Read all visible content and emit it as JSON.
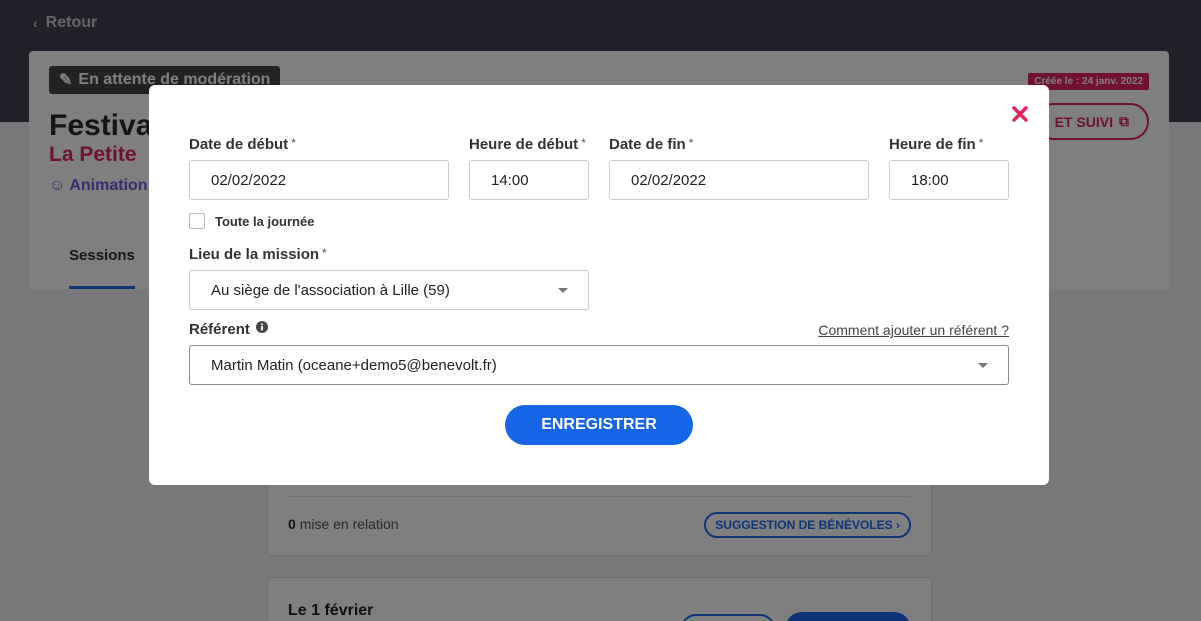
{
  "page": {
    "back_label": "Retour",
    "status_label": "En attente de modération",
    "created_label": "Créée le : 24 janv. 2022",
    "follow_label": "ET SUIVI",
    "mission_title": "Festiva",
    "org_name": "La Petite",
    "domain_label": "Animation",
    "tab_sessions": "Sessions",
    "relations_count": "0",
    "relations_label": "mise en relation",
    "suggest_label": "SUGGESTION DE BÉNÉVOLES",
    "session_date": "Le 1 février"
  },
  "modal": {
    "start_date": {
      "label": "Date de début",
      "required": "*",
      "value": "02/02/2022"
    },
    "start_time": {
      "label": "Heure de début",
      "required": "*",
      "value": "14:00"
    },
    "end_date": {
      "label": "Date de fin",
      "required": "*",
      "value": "02/02/2022"
    },
    "end_time": {
      "label": "Heure de fin",
      "required": "*",
      "value": "18:00"
    },
    "all_day_label": "Toute la journée",
    "location": {
      "label": "Lieu de la mission",
      "required": "*",
      "value": "Au siège de l'association à Lille (59)"
    },
    "referent": {
      "label": "Référent",
      "value": "Martin Matin (oceane+demo5@benevolt.fr)"
    },
    "help_link": "Comment ajouter un référent ?",
    "save_label": "ENREGISTRER",
    "colors": {
      "primary": "#1565e6",
      "close": "#e0245e",
      "accent_pink": "#e0245e"
    }
  }
}
